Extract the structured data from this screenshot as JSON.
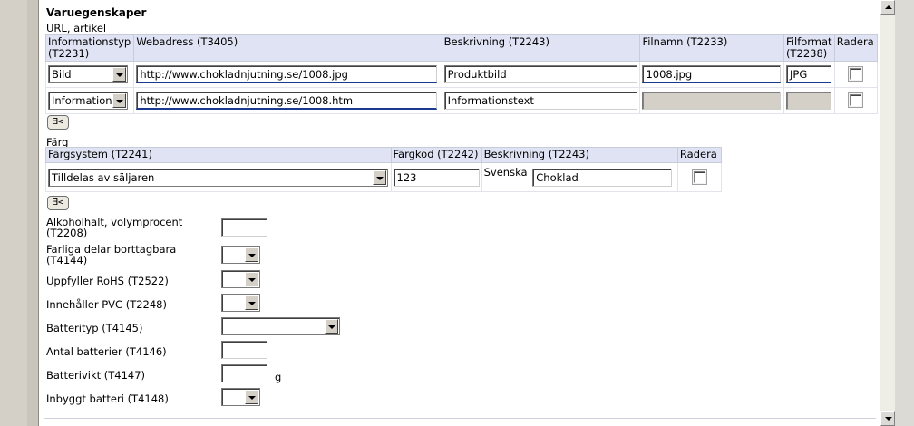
{
  "section_title": "Varuegenskaper",
  "url_group_label": "URL, artikel",
  "url_table": {
    "headers": {
      "info_type": "Informationstyp (T2231)",
      "webaddress": "Webadress (T3405)",
      "description": "Beskrivning (T2243)",
      "filename": "Filnamn (T2233)",
      "fileformat": "Filformat (T2238)",
      "delete": "Radera"
    },
    "rows": [
      {
        "info_type": "Bild",
        "webaddress": "http://www.chokladnjutning.se/1008.jpg",
        "description": "Produktbild",
        "filename": "1008.jpg",
        "fileformat": "JPG"
      },
      {
        "info_type": "Information",
        "webaddress": "http://www.chokladnjutning.se/1008.htm",
        "description": "Informationstext",
        "filename": "",
        "fileformat": ""
      }
    ]
  },
  "add_button_label": "Ǝ<",
  "color_group_label": "Färg",
  "color_table": {
    "headers": {
      "system": "Färgsystem (T2241)",
      "code": "Färgkod (T2242)",
      "description": "Beskrivning (T2243)",
      "delete": "Radera"
    },
    "row": {
      "system": "Tilldelas av säljaren",
      "code": "123",
      "lang": "Svenska",
      "description": "Choklad"
    }
  },
  "fields": {
    "alcohol": {
      "label": "Alkoholhalt, volymprocent (T2208)",
      "value": ""
    },
    "hazardous_removable": {
      "label": "Farliga delar borttagbara (T4144)",
      "value": ""
    },
    "rohs": {
      "label": "Uppfyller RoHS (T2522)",
      "value": ""
    },
    "pvc": {
      "label": "Innehåller PVC (T2248)",
      "value": ""
    },
    "battery_type": {
      "label": "Batterityp (T4145)",
      "value": ""
    },
    "battery_count": {
      "label": "Antal batterier (T4146)",
      "value": ""
    },
    "battery_weight": {
      "label": "Batterivikt (T4147)",
      "value": "",
      "unit": "g"
    },
    "builtin_battery": {
      "label": "Inbyggt batteri (T4148)",
      "value": ""
    }
  },
  "colors": {
    "header_bg": "#dfe3f3",
    "focus_underline": "#1a3a8f",
    "disabled_bg": "#d4d0c8"
  }
}
